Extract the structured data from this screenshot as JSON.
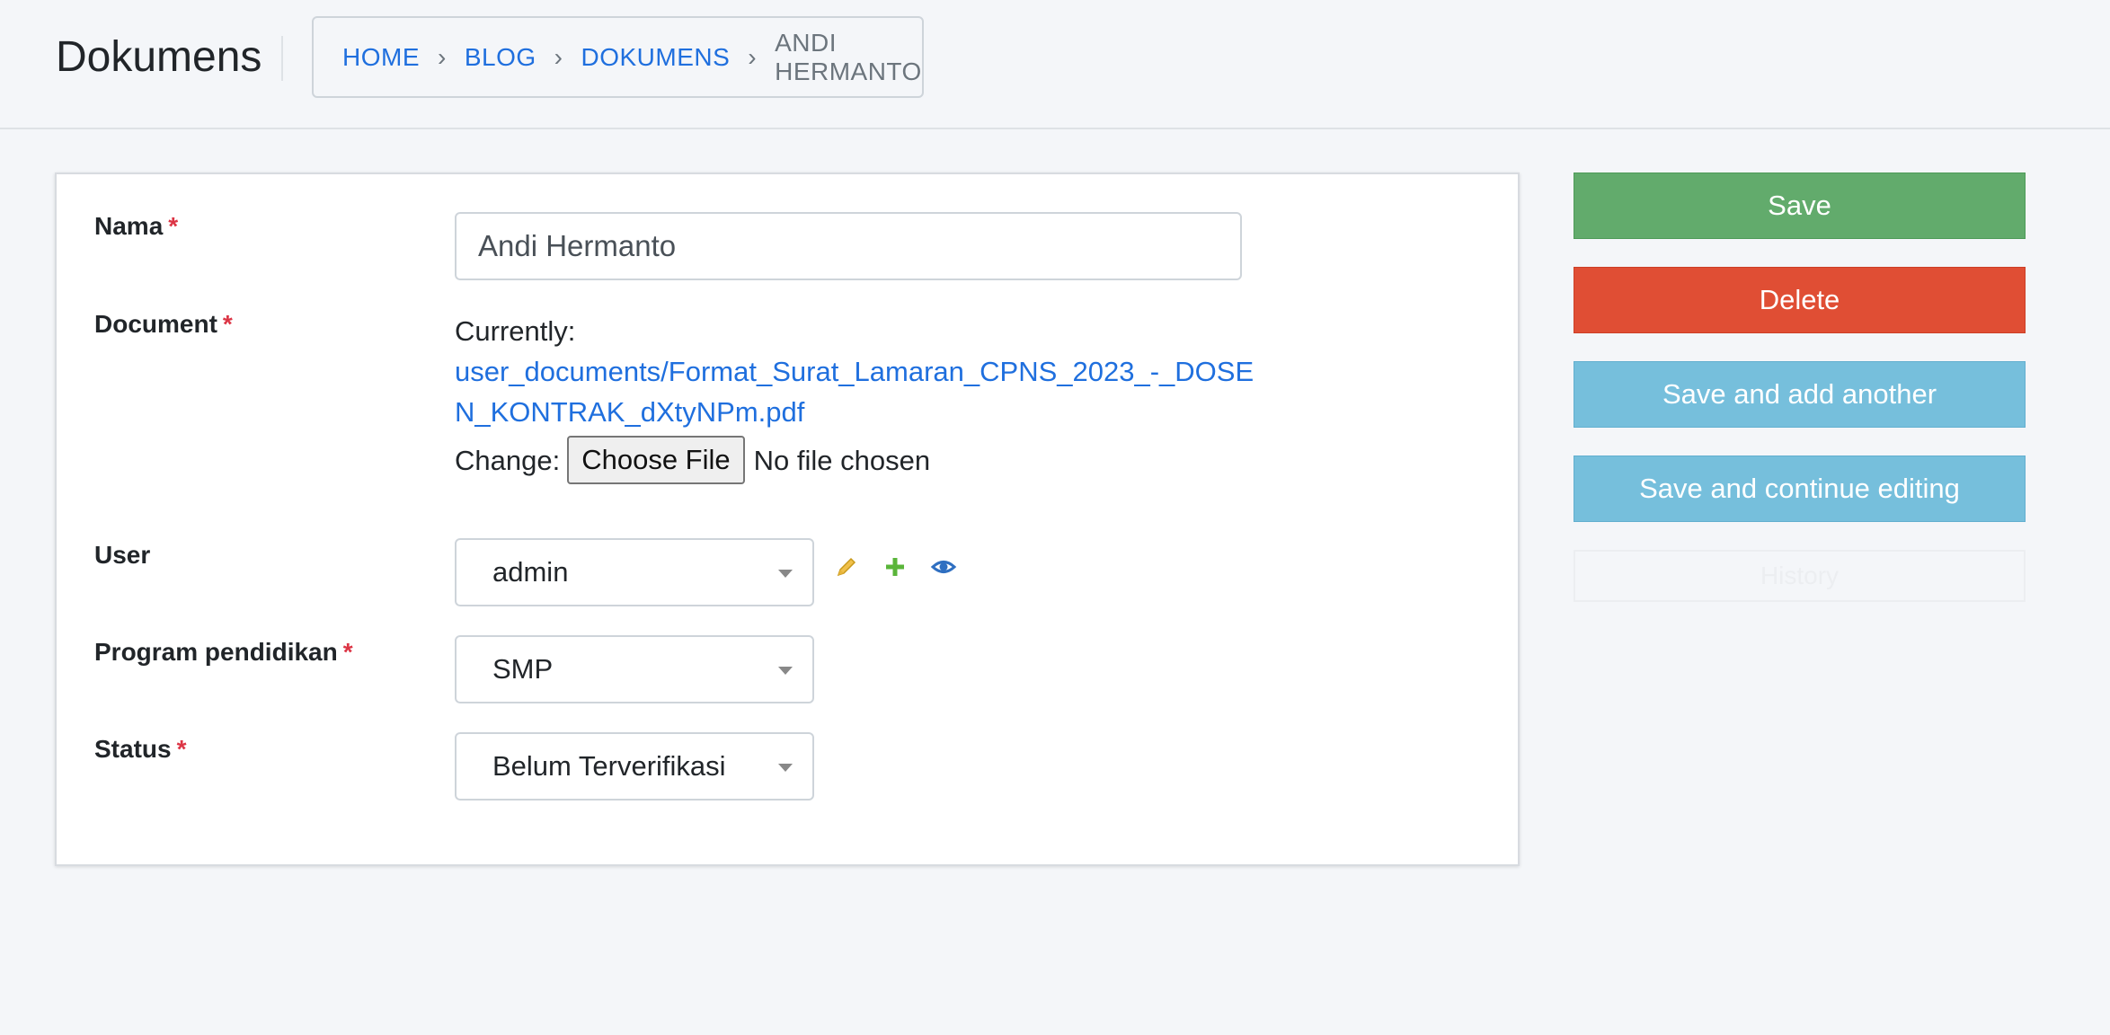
{
  "header": {
    "title": "Dokumens",
    "breadcrumb": [
      "HOME",
      "BLOG",
      "DOKUMENS",
      "ANDI HERMANTO"
    ],
    "separator": "›"
  },
  "form": {
    "nama": {
      "label": "Nama",
      "required": "*",
      "value": "Andi Hermanto"
    },
    "document": {
      "label": "Document",
      "required": "*",
      "currently_label": "Currently:",
      "file_link": "user_documents/Format_Surat_Lamaran_CPNS_2023_-_DOSEN_KONTRAK_dXtyNPm.pdf",
      "change_label": "Change:",
      "choose_button": "Choose File",
      "no_file": "No file chosen"
    },
    "user": {
      "label": "User",
      "value": "admin",
      "icons": [
        "pencil-icon",
        "plus-icon",
        "eye-icon"
      ]
    },
    "program": {
      "label": "Program pendidikan",
      "required": "*",
      "value": "SMP"
    },
    "status": {
      "label": "Status",
      "required": "*",
      "value": "Belum Terverifikasi"
    }
  },
  "actions": {
    "save": "Save",
    "delete": "Delete",
    "save_add": "Save and add another",
    "save_continue": "Save and continue editing",
    "history": "History"
  },
  "colors": {
    "link": "#1f6fde",
    "save": "#62ab6c",
    "delete": "#e04e34",
    "secondary": "#76bfdc",
    "required": "#dc3545"
  }
}
